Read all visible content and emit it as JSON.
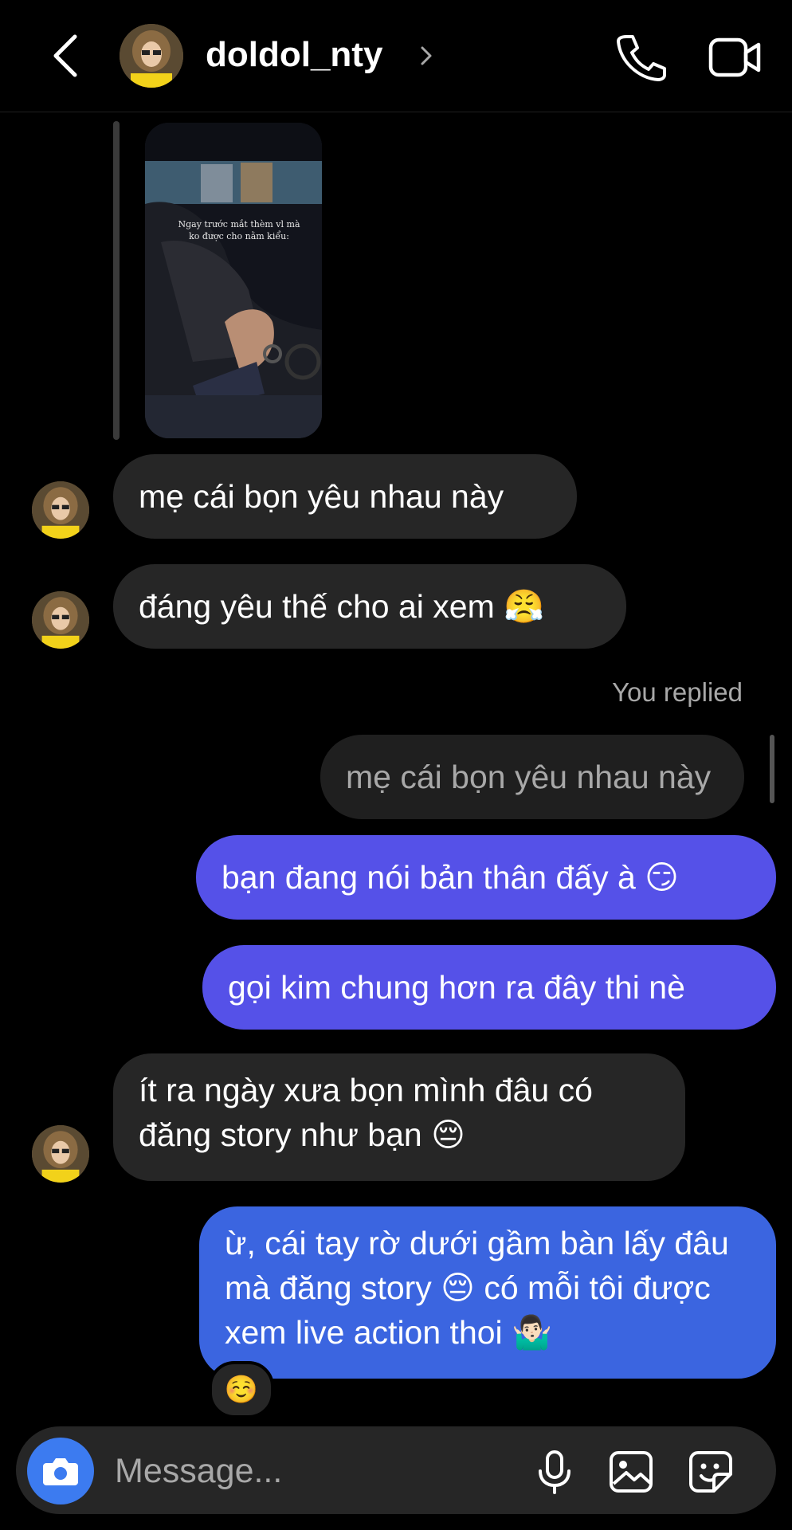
{
  "header": {
    "username": "doldol_nty"
  },
  "story": {
    "caption": "Ngay trước mắt thèm vl mà ko được cho nằm kiểu:"
  },
  "messages": [
    {
      "side": "in",
      "text": "mẹ cái bọn yêu nhau này"
    },
    {
      "side": "in",
      "text": "đáng yêu thế cho ai xem 😤"
    },
    {
      "side": "out",
      "text": "bạn đang nói bản thân đấy à 😏"
    },
    {
      "side": "out",
      "text": "gọi kim chung hơn ra đây thi nè"
    },
    {
      "side": "in",
      "text": "ít ra ngày xưa bọn mình đâu có đăng story như bạn 😔"
    },
    {
      "side": "out",
      "text": "ừ, cái tay rờ dưới gầm bàn lấy đâu mà đăng story 😔 có mỗi tôi được xem live action thoi 🤷🏻‍♂️"
    }
  ],
  "reply": {
    "label": "You replied",
    "quoted": "mẹ cái bọn yêu nhau này"
  },
  "reaction": "☺️",
  "composer": {
    "placeholder": "Message..."
  },
  "colors": {
    "outgoing": "#5551e8",
    "outgoing_last": "#3b65e0",
    "incoming": "#262626",
    "camera": "#3c7bf0"
  },
  "icons": [
    "back-arrow-icon",
    "chevron-right-icon",
    "phone-icon",
    "video-camera-icon",
    "camera-icon",
    "microphone-icon",
    "gallery-icon",
    "sticker-icon"
  ]
}
